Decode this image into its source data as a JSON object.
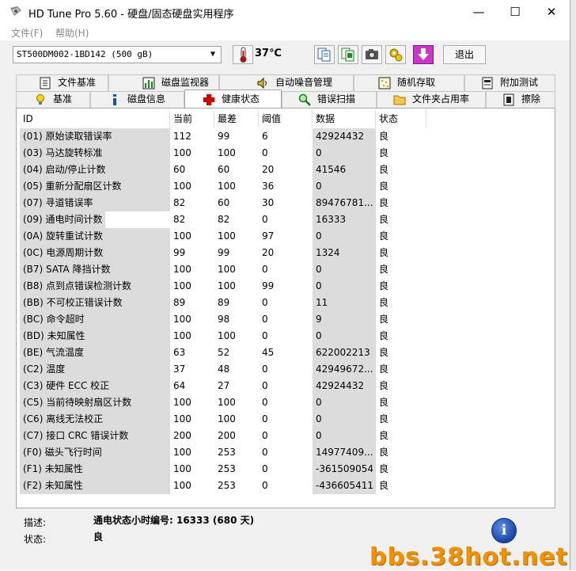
{
  "window": {
    "title": "HD Tune Pro 5.60 - 硬盘/固态硬盘实用程序",
    "minimize_symbol": "—",
    "maximize_symbol": "☐",
    "close_symbol": "✕"
  },
  "menu": {
    "items": [
      "文件(F)",
      "帮助(H)"
    ]
  },
  "toolbar": {
    "drive": "ST500DM002-1BD142 (500 gB)",
    "temperature": "37℃",
    "exit_label": "退出",
    "icons": [
      "thermometer-icon",
      "copy-text-icon",
      "copy-screen-icon",
      "camera-icon",
      "health-gear-icon",
      "download-icon"
    ]
  },
  "tabs": {
    "row1": [
      "文件基准",
      "磁盘监视器",
      "自动噪音管理",
      "随机存取",
      "附加测试"
    ],
    "row2": [
      "基准",
      "磁盘信息",
      "健康状态",
      "错误扫描",
      "文件夹占用率",
      "擦除"
    ],
    "active": "健康状态"
  },
  "table": {
    "columns": [
      "ID",
      "当前",
      "最差",
      "阈值",
      "数据",
      "状态"
    ],
    "rows": [
      [
        "(01) 原始读取错误率",
        "112",
        "99",
        "6",
        "42924432",
        "良"
      ],
      [
        "(03) 马达旋转标准",
        "100",
        "100",
        "0",
        "0",
        "良"
      ],
      [
        "(04) 启动/停止计数",
        "60",
        "60",
        "20",
        "41546",
        "良"
      ],
      [
        "(05) 重新分配扇区计数",
        "100",
        "100",
        "36",
        "0",
        "良"
      ],
      [
        "(07) 寻道错误率",
        "82",
        "60",
        "30",
        "89476781...",
        "良"
      ],
      [
        "(09) 通电时间计数",
        "82",
        "82",
        "0",
        "16333",
        "良"
      ],
      [
        "(0A) 旋转重试计数",
        "100",
        "100",
        "97",
        "0",
        "良"
      ],
      [
        "(0C) 电源周期计数",
        "99",
        "99",
        "20",
        "1324",
        "良"
      ],
      [
        "(B7) SATA 降挡计数",
        "100",
        "100",
        "0",
        "0",
        "良"
      ],
      [
        "(B8) 点到点错误检测计数",
        "100",
        "100",
        "99",
        "0",
        "良"
      ],
      [
        "(BB) 不可校正错误计数",
        "89",
        "89",
        "0",
        "11",
        "良"
      ],
      [
        "(BC) 命令超时",
        "100",
        "98",
        "0",
        "9",
        "良"
      ],
      [
        "(BD) 未知属性",
        "100",
        "100",
        "0",
        "0",
        "良"
      ],
      [
        "(BE) 气流温度",
        "63",
        "52",
        "45",
        "622002213",
        "良"
      ],
      [
        "(C2) 温度",
        "37",
        "48",
        "0",
        "42949672...",
        "良"
      ],
      [
        "(C3) 硬件 ECC 校正",
        "64",
        "27",
        "0",
        "42924432",
        "良"
      ],
      [
        "(C5) 当前待映射扇区计数",
        "100",
        "100",
        "0",
        "0",
        "良"
      ],
      [
        "(C6) 离线无法校正",
        "100",
        "100",
        "0",
        "0",
        "良"
      ],
      [
        "(C7) 接口 CRC 错误计数",
        "200",
        "200",
        "0",
        "0",
        "良"
      ],
      [
        "(F0) 磁头飞行时间",
        "100",
        "253",
        "0",
        "14977409...",
        "良"
      ],
      [
        "(F1) 未知属性",
        "100",
        "253",
        "0",
        "-361509054",
        "良"
      ],
      [
        "(F2) 未知属性",
        "100",
        "253",
        "0",
        "-436605411",
        "良"
      ]
    ],
    "selected_row": 5
  },
  "description": {
    "desc_label": "描述:",
    "desc_value": "通电状态小时编号: 16333 (680 天)",
    "status_label": "状态:",
    "status_value": "良"
  },
  "info_icon_text": "i",
  "watermark": "bbs.38hot.net",
  "colors": {
    "shade": "#dcdcdc",
    "health_icon": "#d40000",
    "watermark": "#f29100"
  }
}
